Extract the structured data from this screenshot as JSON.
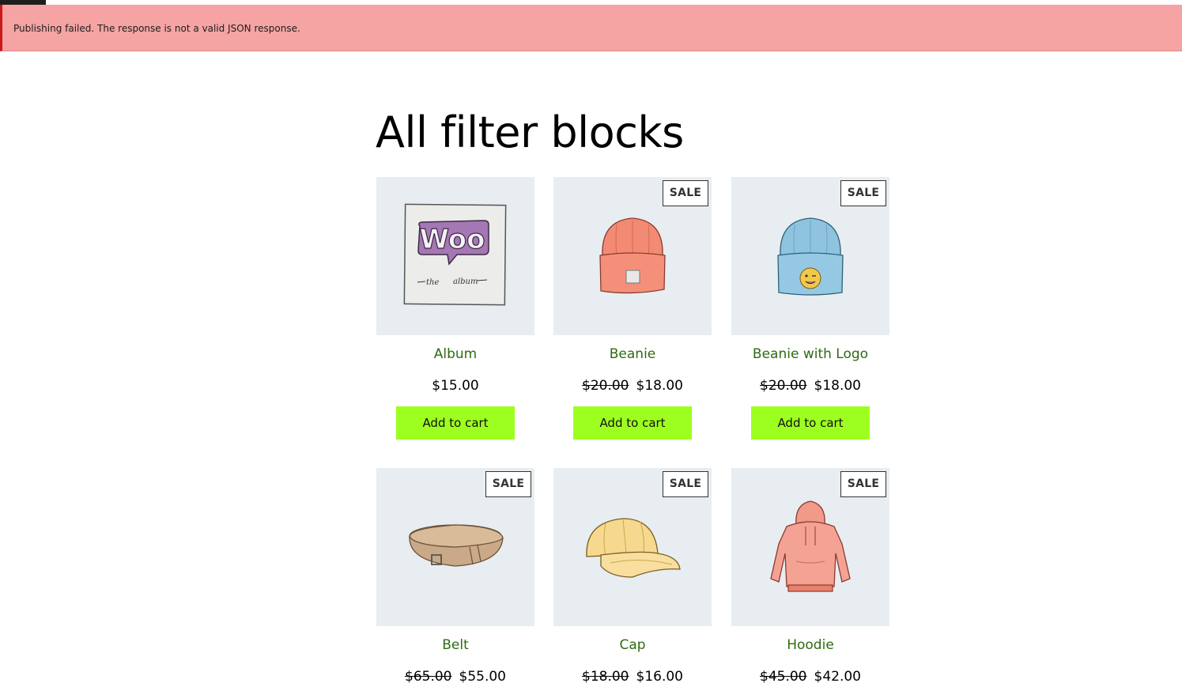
{
  "notice": {
    "message": "Publishing failed. The response is not a valid JSON response.",
    "status": "error",
    "background_color": "#f5a3a3",
    "border_color": "#cc1818"
  },
  "page": {
    "title": "All filter blocks"
  },
  "theme": {
    "product_name_color": "#2e6b12",
    "button_color": "#9dff1f",
    "image_background": "#e8edf1"
  },
  "products": [
    {
      "name": "Album",
      "icon": "album-image",
      "on_sale": false,
      "sale_label": "",
      "regular_price": "",
      "price": "$15.00",
      "button_label": "Add to cart"
    },
    {
      "name": "Beanie",
      "icon": "beanie-image",
      "on_sale": true,
      "sale_label": "SALE",
      "regular_price": "$20.00",
      "price": "$18.00",
      "button_label": "Add to cart"
    },
    {
      "name": "Beanie with Logo",
      "icon": "beanie-with-logo-image",
      "on_sale": true,
      "sale_label": "SALE",
      "regular_price": "$20.00",
      "price": "$18.00",
      "button_label": "Add to cart"
    },
    {
      "name": "Belt",
      "icon": "belt-image",
      "on_sale": true,
      "sale_label": "SALE",
      "regular_price": "$65.00",
      "price": "$55.00",
      "button_label": ""
    },
    {
      "name": "Cap",
      "icon": "cap-image",
      "on_sale": true,
      "sale_label": "SALE",
      "regular_price": "$18.00",
      "price": "$16.00",
      "button_label": ""
    },
    {
      "name": "Hoodie",
      "icon": "hoodie-image",
      "on_sale": true,
      "sale_label": "SALE",
      "regular_price": "$45.00",
      "price": "$42.00",
      "button_label": ""
    }
  ]
}
